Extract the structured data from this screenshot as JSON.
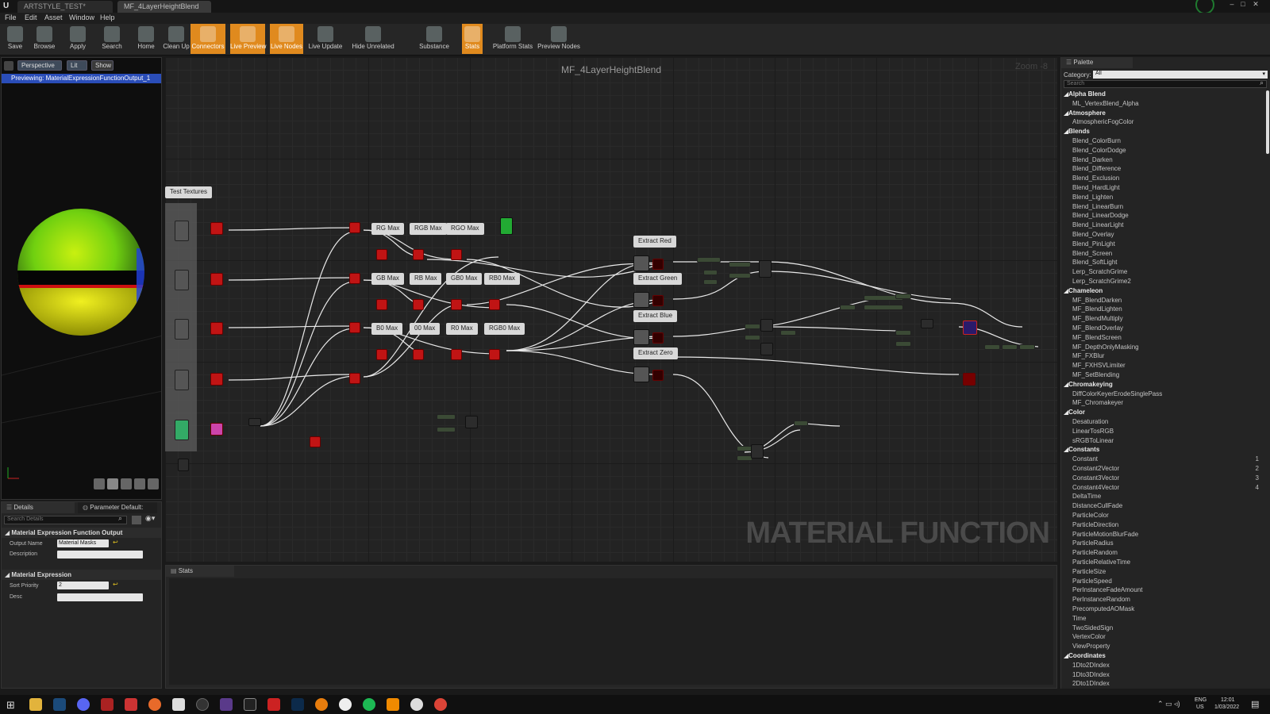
{
  "titlebar": {
    "tabs": [
      "ARTSTYLE_TEST*",
      "MF_4LayerHeightBlend"
    ]
  },
  "menu": [
    "File",
    "Edit",
    "Asset",
    "Window",
    "Help"
  ],
  "toolbar": {
    "buttons": [
      {
        "label": "Save",
        "icon": "save-icon",
        "active": false
      },
      {
        "label": "Browse",
        "icon": "browse-icon",
        "active": false
      },
      {
        "label": "Apply",
        "icon": "apply-icon",
        "active": false
      },
      {
        "label": "Search",
        "icon": "search-icon",
        "active": false
      },
      {
        "label": "Home",
        "icon": "home-icon",
        "active": false
      },
      {
        "label": "Clean Up",
        "icon": "clean-up-icon",
        "active": false
      },
      {
        "label": "Connectors",
        "icon": "connectors-icon",
        "active": true
      },
      {
        "label": "Live Preview",
        "icon": "live-preview-icon",
        "active": true
      },
      {
        "label": "Live Nodes",
        "icon": "live-nodes-icon",
        "active": true
      },
      {
        "label": "Live Update",
        "icon": "live-update-icon",
        "active": false
      },
      {
        "label": "Hide Unrelated",
        "icon": "hide-unrelated-icon",
        "active": false
      },
      {
        "label": "Substance",
        "icon": "substance-icon",
        "active": false
      },
      {
        "label": "Stats",
        "icon": "stats-icon",
        "active": true
      },
      {
        "label": "Platform Stats",
        "icon": "platform-stats-icon",
        "active": false
      },
      {
        "label": "Preview Nodes",
        "icon": "preview-nodes-icon",
        "active": false
      }
    ]
  },
  "viewport": {
    "chips": [
      "Perspective",
      "Lit",
      "Show"
    ],
    "preview_banner": "Previewing: MaterialExpressionFunctionOutput_1"
  },
  "details": {
    "tabs": [
      "Details",
      "Parameter Default:"
    ],
    "search_placeholder": "Search Details",
    "section1": "Material Expression Function Output",
    "output_name_label": "Output Name",
    "output_name_value": "Material Masks",
    "description_label": "Description",
    "section2": "Material Expression",
    "sort_priority_label": "Sort Priority",
    "sort_priority_value": "2",
    "desc_label": "Desc"
  },
  "graph": {
    "title": "MF_4LayerHeightBlend",
    "zoom": "Zoom -8",
    "watermark": "MATERIAL FUNCTION",
    "comments": [
      "Test Textures",
      "RG Max",
      "RGB Max",
      "RGO Max",
      "GB Max",
      "RB Max",
      "GB0 Max",
      "RB0 Max",
      "B0 Max",
      "00 Max",
      "R0 Max",
      "RGB0 Max",
      "Extract Red",
      "Extract Green",
      "Extract Blue",
      "Extract Zero"
    ]
  },
  "stats": {
    "tab": "Stats"
  },
  "palette": {
    "tab": "Palette",
    "category_label": "Category:",
    "category_value": "All",
    "search_placeholder": "Search",
    "rows": [
      {
        "text": "Alpha Blend",
        "type": "cat"
      },
      {
        "text": "ML_VertexBlend_Alpha",
        "type": "item"
      },
      {
        "text": "Atmosphere",
        "type": "cat"
      },
      {
        "text": "AtmosphericFogColor",
        "type": "item"
      },
      {
        "text": "Blends",
        "type": "cat"
      },
      {
        "text": "Blend_ColorBurn",
        "type": "item"
      },
      {
        "text": "Blend_ColorDodge",
        "type": "item"
      },
      {
        "text": "Blend_Darken",
        "type": "item"
      },
      {
        "text": "Blend_Difference",
        "type": "item"
      },
      {
        "text": "Blend_Exclusion",
        "type": "item"
      },
      {
        "text": "Blend_HardLight",
        "type": "item"
      },
      {
        "text": "Blend_Lighten",
        "type": "item"
      },
      {
        "text": "Blend_LinearBurn",
        "type": "item"
      },
      {
        "text": "Blend_LinearDodge",
        "type": "item"
      },
      {
        "text": "Blend_LinearLight",
        "type": "item"
      },
      {
        "text": "Blend_Overlay",
        "type": "item"
      },
      {
        "text": "Blend_PinLight",
        "type": "item"
      },
      {
        "text": "Blend_Screen",
        "type": "item"
      },
      {
        "text": "Blend_SoftLight",
        "type": "item"
      },
      {
        "text": "Lerp_ScratchGrime",
        "type": "item"
      },
      {
        "text": "Lerp_ScratchGrime2",
        "type": "item"
      },
      {
        "text": "Chameleon",
        "type": "cat"
      },
      {
        "text": "MF_BlendDarken",
        "type": "item"
      },
      {
        "text": "MF_BlendLighten",
        "type": "item"
      },
      {
        "text": "MF_BlendMultiply",
        "type": "item"
      },
      {
        "text": "MF_BlendOverlay",
        "type": "item"
      },
      {
        "text": "MF_BlendScreen",
        "type": "item"
      },
      {
        "text": "MF_DepthOnlyMasking",
        "type": "item"
      },
      {
        "text": "MF_FXBlur",
        "type": "item"
      },
      {
        "text": "MF_FXHSVLimiter",
        "type": "item"
      },
      {
        "text": "MF_SetBlending",
        "type": "item"
      },
      {
        "text": "Chromakeying",
        "type": "cat"
      },
      {
        "text": "DiffColorKeyerErodeSinglePass",
        "type": "item"
      },
      {
        "text": "MF_Chromakeyer",
        "type": "item"
      },
      {
        "text": "Color",
        "type": "cat"
      },
      {
        "text": "Desaturation",
        "type": "item"
      },
      {
        "text": "LinearTosRGB",
        "type": "item"
      },
      {
        "text": "sRGBToLinear",
        "type": "item"
      },
      {
        "text": "Constants",
        "type": "cat"
      },
      {
        "text": "Constant",
        "type": "item",
        "num": "1"
      },
      {
        "text": "Constant2Vector",
        "type": "item",
        "num": "2"
      },
      {
        "text": "Constant3Vector",
        "type": "item",
        "num": "3"
      },
      {
        "text": "Constant4Vector",
        "type": "item",
        "num": "4"
      },
      {
        "text": "DeltaTime",
        "type": "item"
      },
      {
        "text": "DistanceCullFade",
        "type": "item"
      },
      {
        "text": "ParticleColor",
        "type": "item"
      },
      {
        "text": "ParticleDirection",
        "type": "item"
      },
      {
        "text": "ParticleMotionBlurFade",
        "type": "item"
      },
      {
        "text": "ParticleRadius",
        "type": "item"
      },
      {
        "text": "ParticleRandom",
        "type": "item"
      },
      {
        "text": "ParticleRelativeTime",
        "type": "item"
      },
      {
        "text": "ParticleSize",
        "type": "item"
      },
      {
        "text": "ParticleSpeed",
        "type": "item"
      },
      {
        "text": "PerInstanceFadeAmount",
        "type": "item"
      },
      {
        "text": "PerInstanceRandom",
        "type": "item"
      },
      {
        "text": "PrecomputedAOMask",
        "type": "item"
      },
      {
        "text": "Time",
        "type": "item"
      },
      {
        "text": "TwoSidedSign",
        "type": "item"
      },
      {
        "text": "VertexColor",
        "type": "item"
      },
      {
        "text": "ViewProperty",
        "type": "item"
      },
      {
        "text": "Coordinates",
        "type": "cat"
      },
      {
        "text": "1Dto2DIndex",
        "type": "item"
      },
      {
        "text": "1Dto3DIndex",
        "type": "item"
      },
      {
        "text": "2Dto1DIndex",
        "type": "item"
      }
    ]
  },
  "taskbar": {
    "lang": "ENG",
    "region": "US",
    "time": "12:01",
    "date": "1/03/2022"
  },
  "colors": {
    "accent": "#e08a1e",
    "selection": "#2a4db8",
    "node_red": "#c01414"
  }
}
